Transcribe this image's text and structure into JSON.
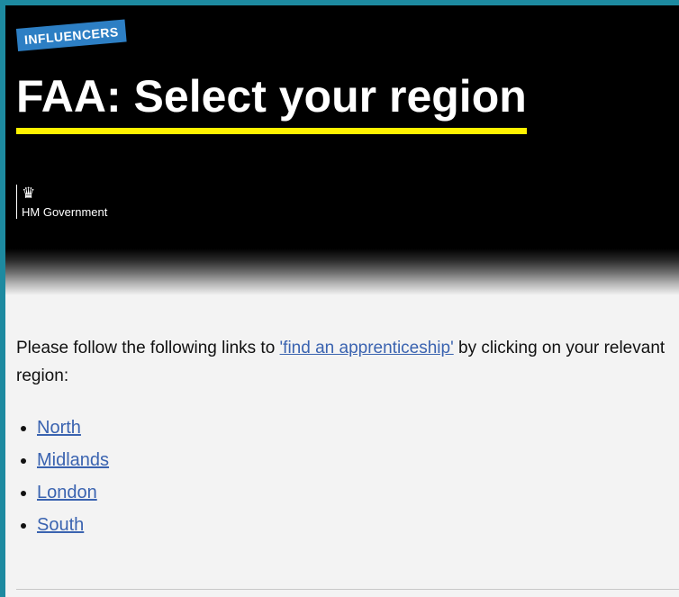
{
  "header": {
    "badge": "INFLUENCERS",
    "title": "FAA: Select your region",
    "org_crest": "♛",
    "org_name": "HM Government"
  },
  "content": {
    "intro_before": "Please follow the following links to ",
    "intro_link": "'find an apprenticeship'",
    "intro_after": " by clicking on your relevant region:",
    "regions": [
      {
        "label": "North"
      },
      {
        "label": "Midlands"
      },
      {
        "label": "London"
      },
      {
        "label": "South"
      }
    ]
  },
  "colors": {
    "frame": "#1d8aa0",
    "header_bg": "#000000",
    "underline": "#fff200",
    "badge": "#2d7fc4",
    "link": "#3a63b0",
    "page_bg": "#f3f3f3"
  }
}
